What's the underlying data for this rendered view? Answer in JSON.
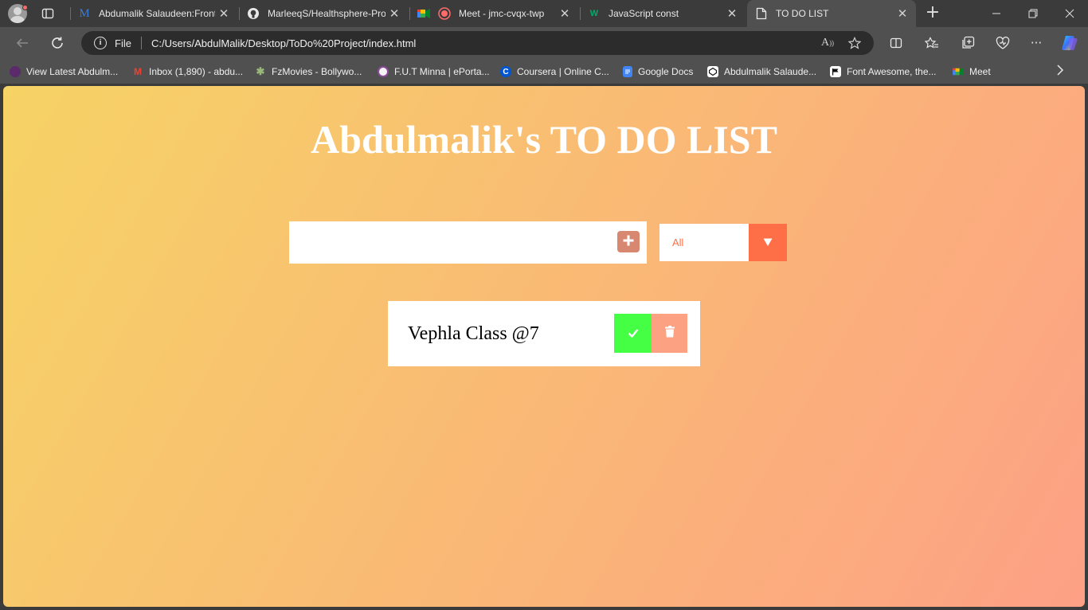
{
  "browser": {
    "tabs": [
      {
        "title": "Abdumalik Salaudeen:Fronte",
        "favicon": "medium-m-icon",
        "active": false
      },
      {
        "title": "MarleeqS/Healthsphere-Pro",
        "favicon": "github-icon",
        "active": false
      },
      {
        "title": "Meet - jmc-cvqx-twp",
        "favicon": "google-meet-icon",
        "active": false
      },
      {
        "title": "JavaScript const",
        "favicon": "w3schools-icon",
        "active": false
      },
      {
        "title": "TO DO LIST",
        "favicon": "file-icon",
        "active": true
      }
    ],
    "address": {
      "scheme_label": "File",
      "url": "C:/Users/AbdulMalik/Desktop/ToDo%20Project/index.html"
    },
    "bookmarks": [
      {
        "label": "View Latest Abdulm...",
        "icon": "grape-icon",
        "color": "#5a2a6a"
      },
      {
        "label": "Inbox (1,890) - abdu...",
        "icon": "gmail-icon",
        "color": "#ea4335"
      },
      {
        "label": "FzMovies - Bollywo...",
        "icon": "palm-icon",
        "color": "#7a9a5a"
      },
      {
        "label": "F.U.T Minna | ePorta...",
        "icon": "university-seal-icon",
        "color": "#8a4a9a"
      },
      {
        "label": "Coursera | Online C...",
        "icon": "coursera-icon",
        "color": "#0056d2"
      },
      {
        "label": "Google Docs",
        "icon": "google-docs-icon",
        "color": "#4285f4"
      },
      {
        "label": "Abdulmalik Salaude...",
        "icon": "codepen-icon",
        "color": "#111111"
      },
      {
        "label": "Font Awesome, the...",
        "icon": "font-awesome-flag-icon",
        "color": "#111111"
      },
      {
        "label": "Meet",
        "icon": "google-meet-icon",
        "color": "#00ac47"
      }
    ]
  },
  "page": {
    "title": "Abdulmalik's TO DO LIST",
    "input": {
      "value": "",
      "placeholder": ""
    },
    "filter": {
      "selected": "All",
      "accent": "#ff6f47"
    },
    "todos": [
      {
        "text": "Vephla Class @7",
        "completed": false
      }
    ],
    "colors": {
      "gradient_start": "#f6d365",
      "gradient_end": "#fda085",
      "add_button": "#d88771",
      "complete_button": "#45ff45",
      "trash_button": "#fca283"
    }
  }
}
